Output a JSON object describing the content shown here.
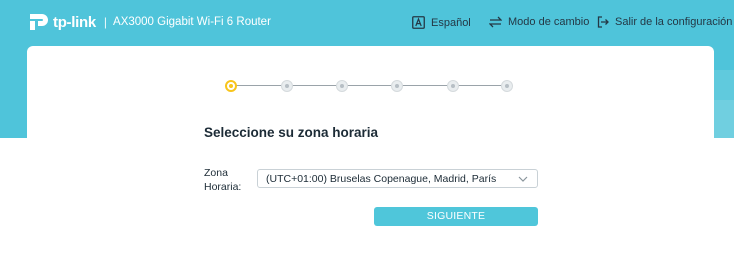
{
  "header": {
    "brand": "tp-link",
    "separator": "|",
    "model": "AX3000 Gigabit Wi-Fi 6 Router",
    "nav": [
      {
        "label": "Español",
        "icon": "language-a-icon"
      },
      {
        "label": "Modo de cambio",
        "icon": "swap-arrows-icon"
      },
      {
        "label": "Salir de la configuración",
        "icon": "exit-icon"
      }
    ]
  },
  "colors": {
    "accent": "#4fc4da",
    "active_step": "#f8c51c",
    "text_dark": "#1c2b36"
  },
  "wizard": {
    "total_steps": 6,
    "current_step": 1,
    "title": "Seleccione su zona horaria",
    "timezone_label_line1": "Zona",
    "timezone_label_line2": "Horaria:",
    "timezone_value": "(UTC+01:00) Bruselas Copenague, Madrid, París",
    "next_button": "SIGUIENTE"
  }
}
